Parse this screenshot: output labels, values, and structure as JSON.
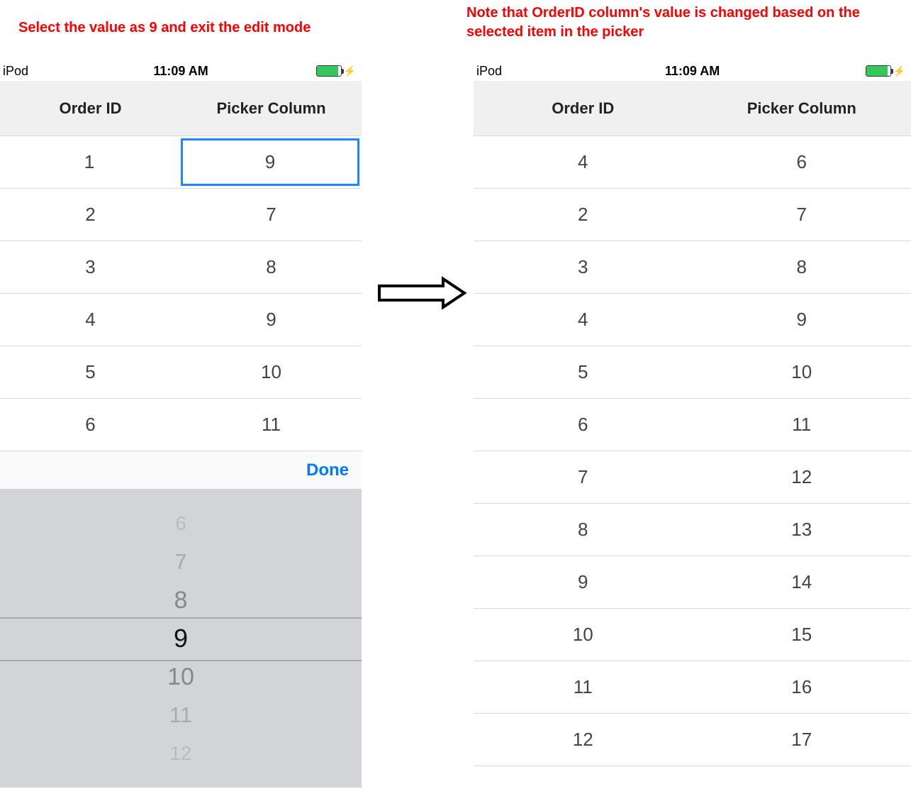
{
  "captions": {
    "left": "Select the value as 9 and exit the edit mode",
    "right": "Note that OrderID column's value is changed based on the selected item in the picker"
  },
  "status": {
    "carrier": "iPod",
    "time": "11:09 AM"
  },
  "headers": {
    "order_id": "Order ID",
    "picker_col": "Picker Column"
  },
  "left_grid": {
    "editing_value": "9",
    "rows": [
      {
        "order": "1",
        "picker": "9"
      },
      {
        "order": "2",
        "picker": "7"
      },
      {
        "order": "3",
        "picker": "8"
      },
      {
        "order": "4",
        "picker": "9"
      },
      {
        "order": "5",
        "picker": "10"
      },
      {
        "order": "6",
        "picker": "11"
      }
    ]
  },
  "right_grid": {
    "rows": [
      {
        "order": "4",
        "picker": "6"
      },
      {
        "order": "2",
        "picker": "7"
      },
      {
        "order": "3",
        "picker": "8"
      },
      {
        "order": "4",
        "picker": "9"
      },
      {
        "order": "5",
        "picker": "10"
      },
      {
        "order": "6",
        "picker": "11"
      },
      {
        "order": "7",
        "picker": "12"
      },
      {
        "order": "8",
        "picker": "13"
      },
      {
        "order": "9",
        "picker": "14"
      },
      {
        "order": "10",
        "picker": "15"
      },
      {
        "order": "11",
        "picker": "16"
      },
      {
        "order": "12",
        "picker": "17"
      }
    ]
  },
  "picker": {
    "done_label": "Done",
    "items": [
      "6",
      "7",
      "8",
      "9",
      "10",
      "11",
      "12"
    ],
    "selected_index": 3
  }
}
